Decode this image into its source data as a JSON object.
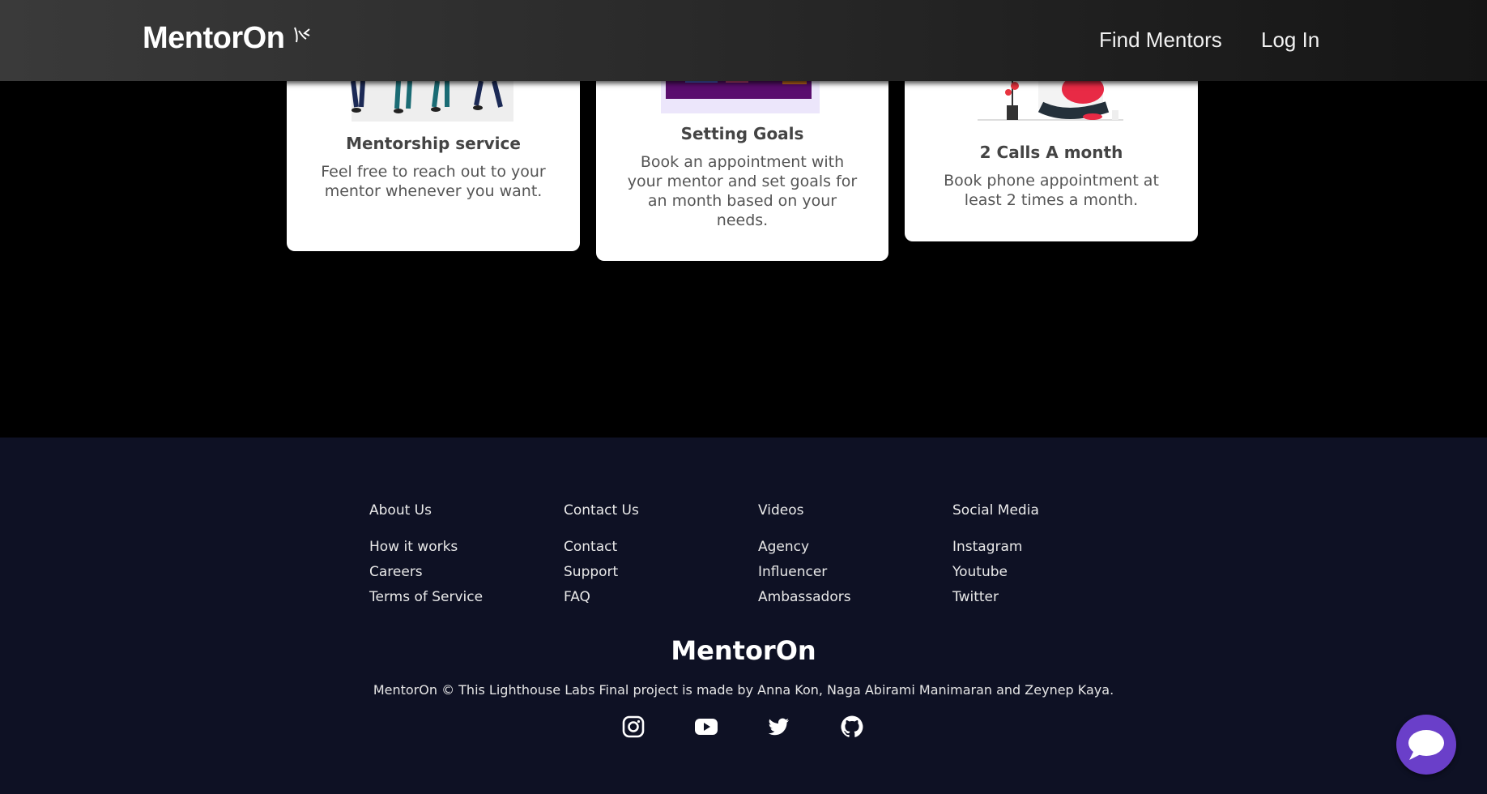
{
  "header": {
    "logo": "MentorOn",
    "nav": {
      "find_mentors": "Find Mentors",
      "log_in": "Log In"
    }
  },
  "cards": [
    {
      "title": "Mentorship service",
      "description": "Feel free to reach out to your mentor whenever you want."
    },
    {
      "title": "Setting Goals",
      "description": "Book an appointment with your mentor and set goals for an month based on your needs."
    },
    {
      "title": "2 Calls A month",
      "description": "Book phone appointment at least 2 times a month."
    }
  ],
  "footer": {
    "columns": [
      {
        "heading": "About Us",
        "links": [
          "How it works",
          "Careers",
          "Terms of Service"
        ]
      },
      {
        "heading": "Contact Us",
        "links": [
          "Contact",
          "Support",
          "FAQ"
        ]
      },
      {
        "heading": "Videos",
        "links": [
          "Agency",
          "Influencer",
          "Ambassadors"
        ]
      },
      {
        "heading": "Social Media",
        "links": [
          "Instagram",
          "Youtube",
          "Twitter"
        ]
      }
    ],
    "brand": "MentorOn",
    "copyright": "MentorOn © This Lighthouse Labs Final project is made by Anna Kon, Naga Abirami Manimaran and Zeynep Kaya.",
    "social_icons": [
      "instagram-icon",
      "youtube-icon",
      "twitter-icon",
      "github-icon"
    ]
  },
  "chat_widget": {
    "icon": "chat-bubble-icon",
    "color": "#6a3fc9"
  },
  "colors": {
    "header_bg": "#2a2a2a",
    "page_bg": "#000000",
    "footer_bg": "#0e1124",
    "card_bg": "#ffffff"
  }
}
